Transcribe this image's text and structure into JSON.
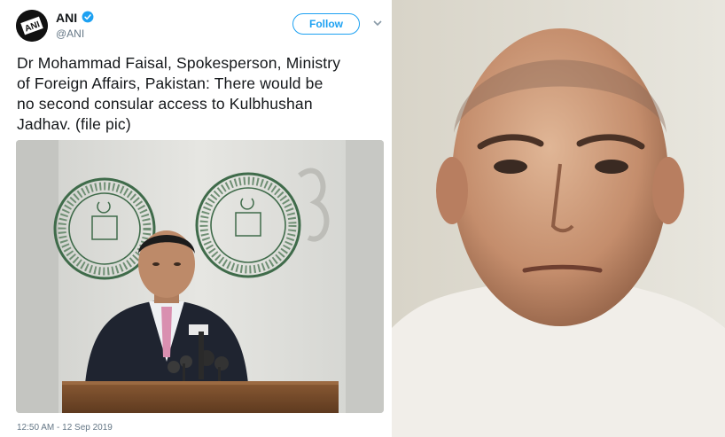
{
  "tweet": {
    "author_name": "ANI",
    "author_handle": "@ANI",
    "avatar_text": "ANI",
    "follow_label": "Follow",
    "text": "Dr Mohammad Faisal, Spokesperson, Ministry\nof Foreign Affairs, Pakistan: There would be\nno second consular access to Kulbhushan\nJadhav. (file pic)",
    "timestamp": "12:50 AM - 12 Sep 2019",
    "photo": {
      "seal_text": "MINISTRY OF FOREIGN AFFAIRS · GOVERNMENT OF PAKISTAN"
    }
  },
  "colors": {
    "accent": "#1da1f2",
    "text": "#14171a",
    "muted": "#657786"
  },
  "icons": {
    "verified": "verified-badge-icon",
    "more": "chevron-down-icon"
  }
}
